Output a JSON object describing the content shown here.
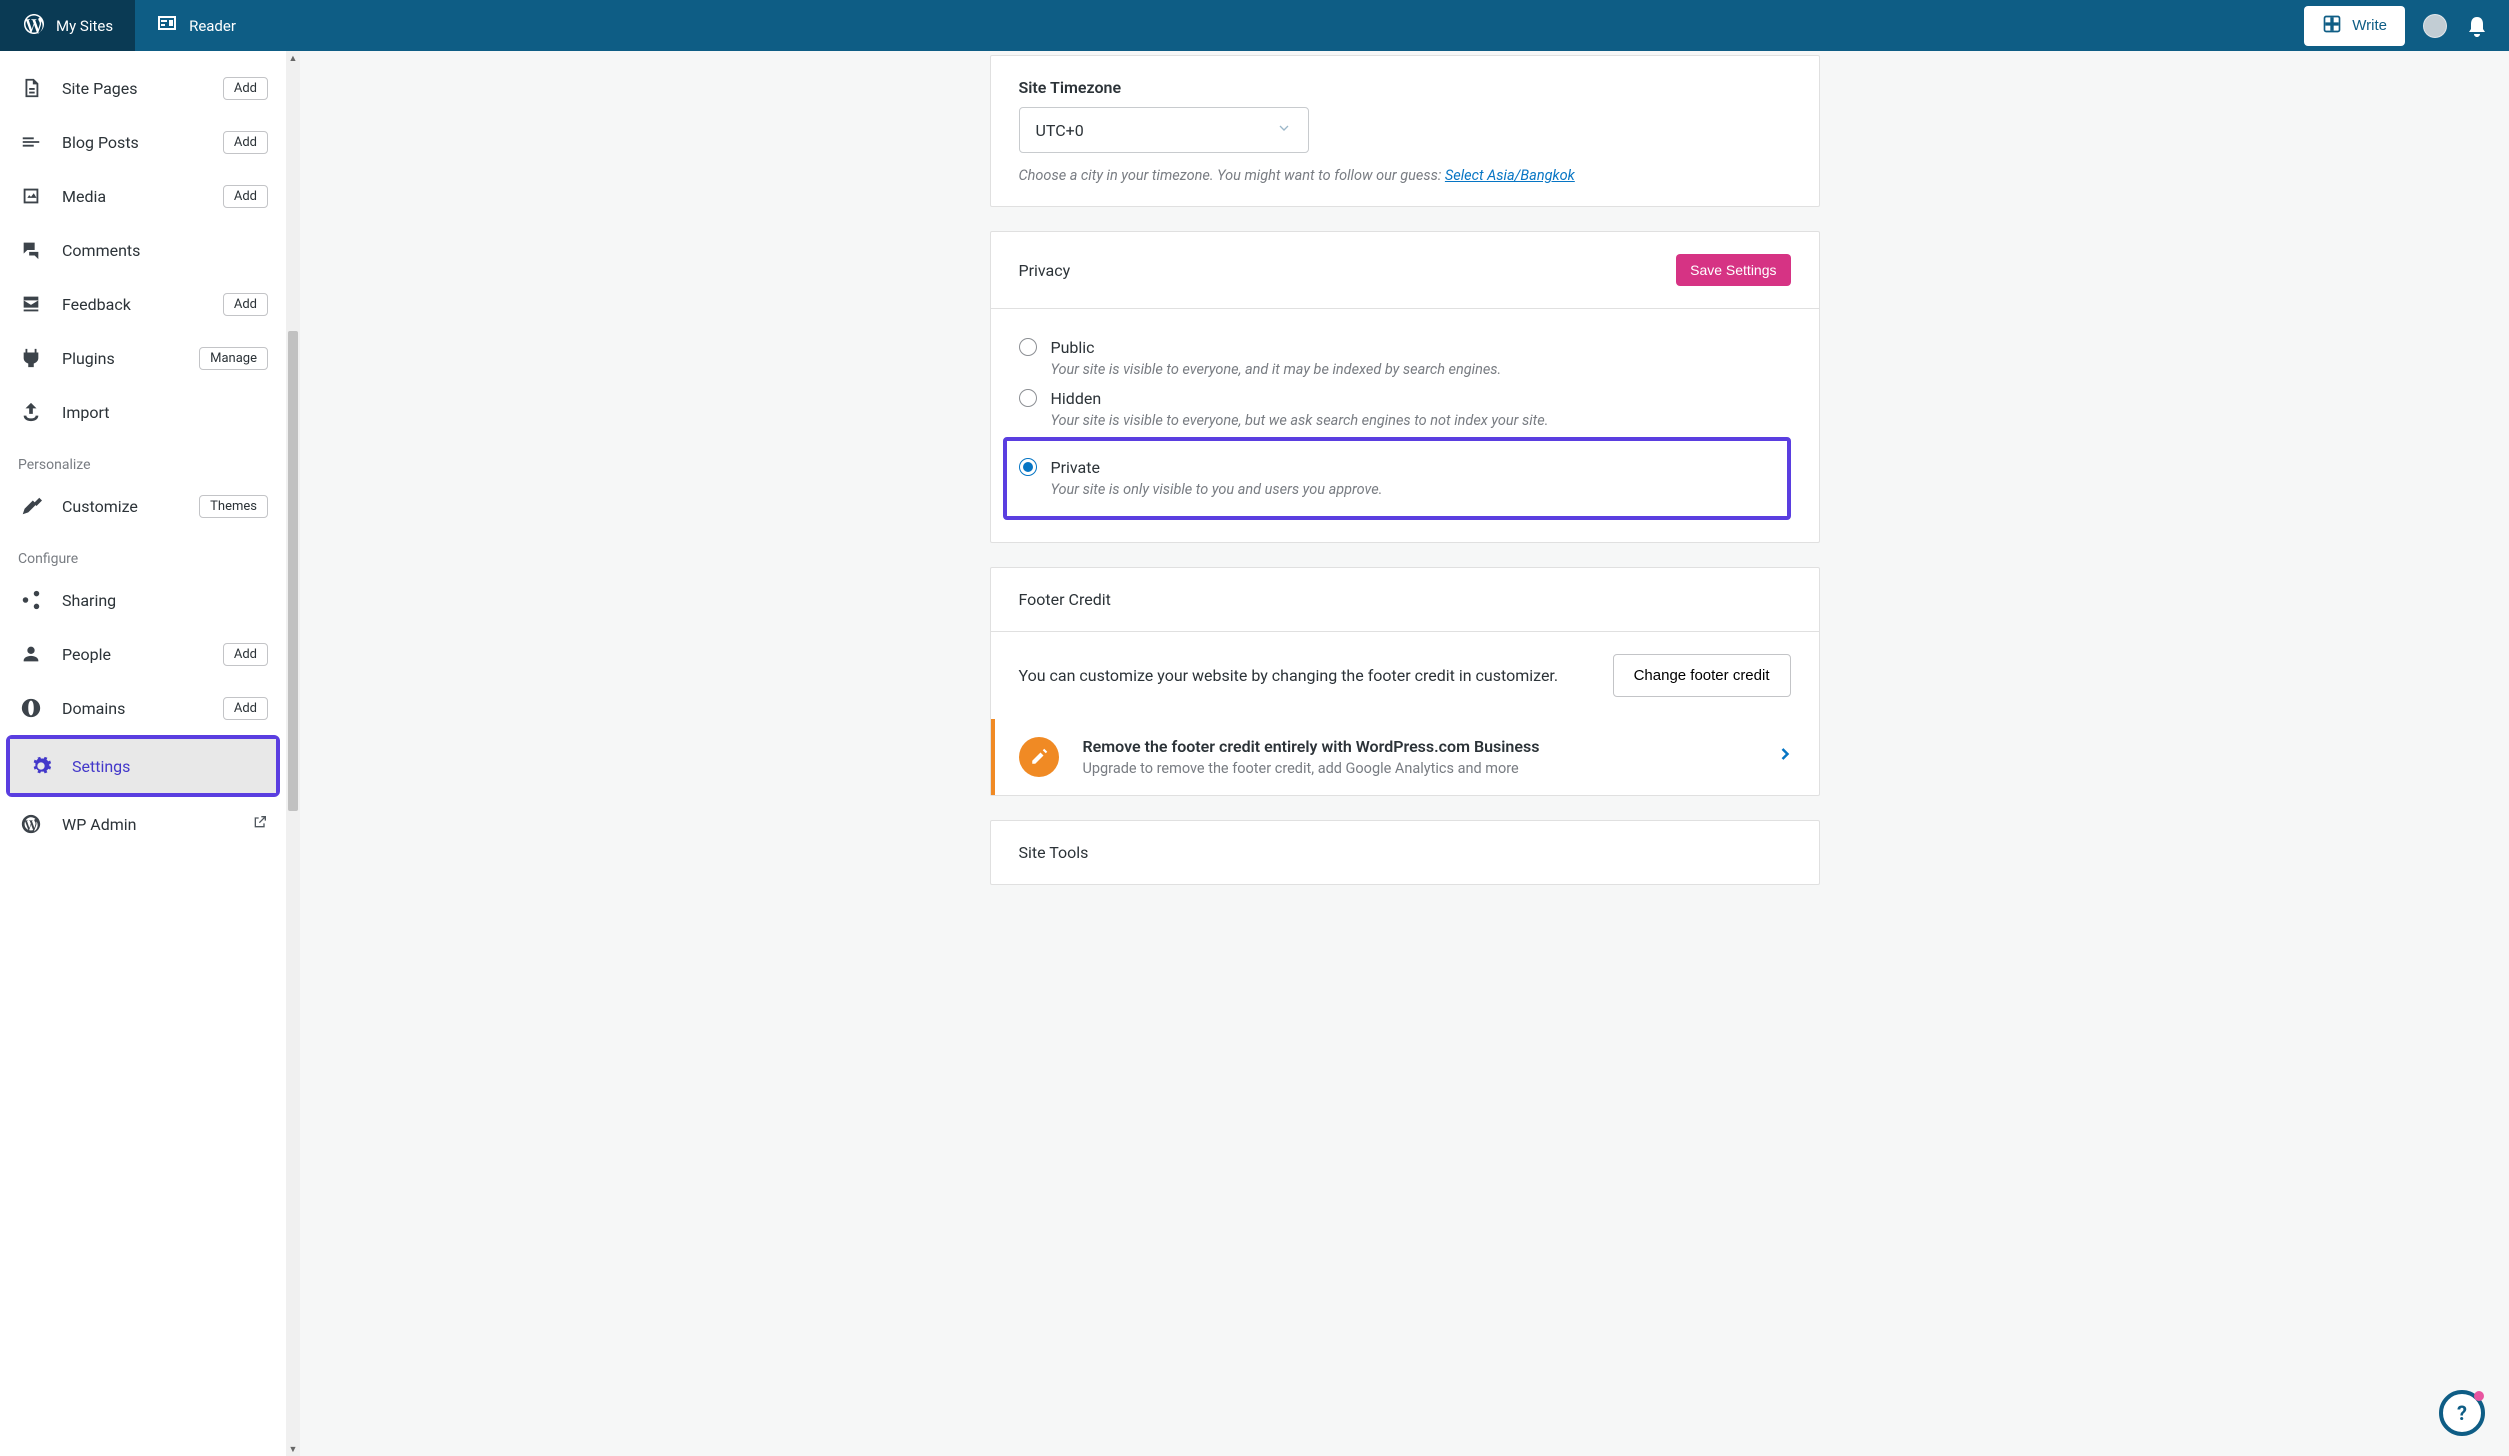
{
  "topbar": {
    "my_sites": "My Sites",
    "reader": "Reader",
    "write": "Write"
  },
  "sidebar": {
    "items": [
      {
        "label": "Site Pages",
        "chip": "Add",
        "icon": "page-icon"
      },
      {
        "label": "Blog Posts",
        "chip": "Add",
        "icon": "posts-icon"
      },
      {
        "label": "Media",
        "chip": "Add",
        "icon": "media-icon"
      },
      {
        "label": "Comments",
        "chip": null,
        "icon": "comments-icon"
      },
      {
        "label": "Feedback",
        "chip": "Add",
        "icon": "feedback-icon"
      },
      {
        "label": "Plugins",
        "chip": "Manage",
        "icon": "plugins-icon"
      },
      {
        "label": "Import",
        "chip": null,
        "icon": "import-icon"
      }
    ],
    "personalize_label": "Personalize",
    "customize": {
      "label": "Customize",
      "chip": "Themes"
    },
    "configure_label": "Configure",
    "configure_items": [
      {
        "label": "Sharing",
        "chip": null,
        "icon": "sharing-icon"
      },
      {
        "label": "People",
        "chip": "Add",
        "icon": "people-icon"
      },
      {
        "label": "Domains",
        "chip": "Add",
        "icon": "domains-icon"
      },
      {
        "label": "Settings",
        "chip": null,
        "icon": "settings-icon",
        "active": true
      },
      {
        "label": "WP Admin",
        "chip": null,
        "icon": "wp-icon",
        "external": true
      }
    ]
  },
  "timezone": {
    "label": "Site Timezone",
    "value": "UTC+0",
    "hint_prefix": "Choose a city in your timezone. You might want to follow our guess: ",
    "hint_link": "Select Asia/Bangkok"
  },
  "privacy": {
    "title": "Privacy",
    "save_label": "Save Settings",
    "options": [
      {
        "label": "Public",
        "desc": "Your site is visible to everyone, and it may be indexed by search engines.",
        "checked": false
      },
      {
        "label": "Hidden",
        "desc": "Your site is visible to everyone, but we ask search engines to not index your site.",
        "checked": false
      },
      {
        "label": "Private",
        "desc": "Your site is only visible to you and users you approve.",
        "checked": true
      }
    ]
  },
  "footer_credit": {
    "title": "Footer Credit",
    "desc": "You can customize your website by changing the footer credit in customizer.",
    "button": "Change footer credit",
    "upsell_title": "Remove the footer credit entirely with WordPress.com Business",
    "upsell_sub": "Upgrade to remove the footer credit, add Google Analytics and more"
  },
  "site_tools": {
    "title": "Site Tools"
  }
}
